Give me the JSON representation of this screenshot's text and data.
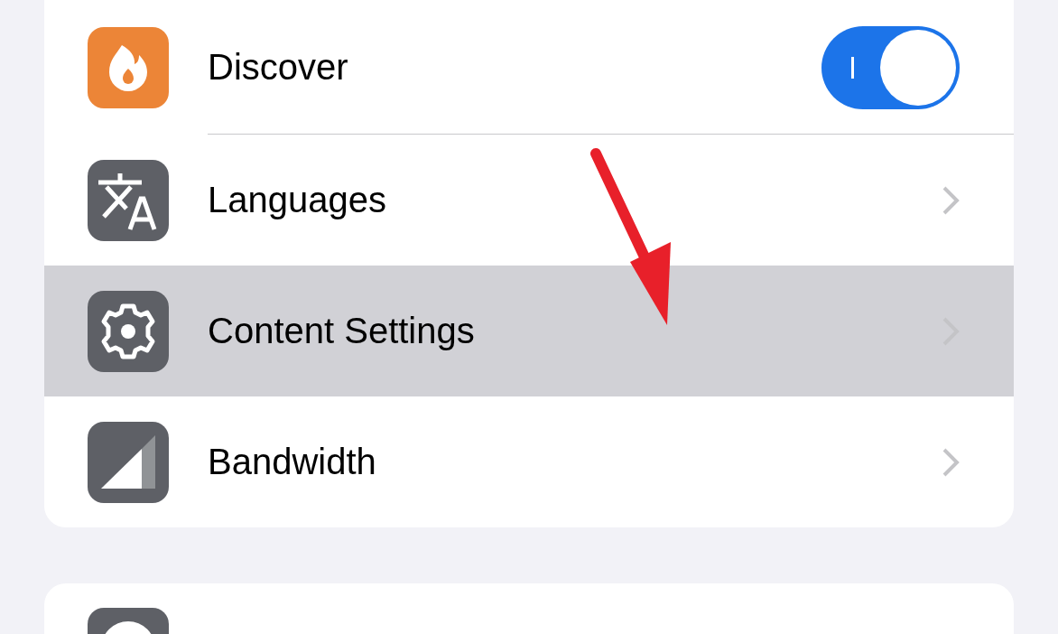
{
  "settings_rows": [
    {
      "kind": "toggle",
      "label": "Discover",
      "on": true,
      "selected": false
    },
    {
      "kind": "link",
      "label": "Languages",
      "selected": false
    },
    {
      "kind": "link",
      "label": "Content Settings",
      "selected": true
    },
    {
      "kind": "link",
      "label": "Bandwidth",
      "selected": false
    }
  ]
}
